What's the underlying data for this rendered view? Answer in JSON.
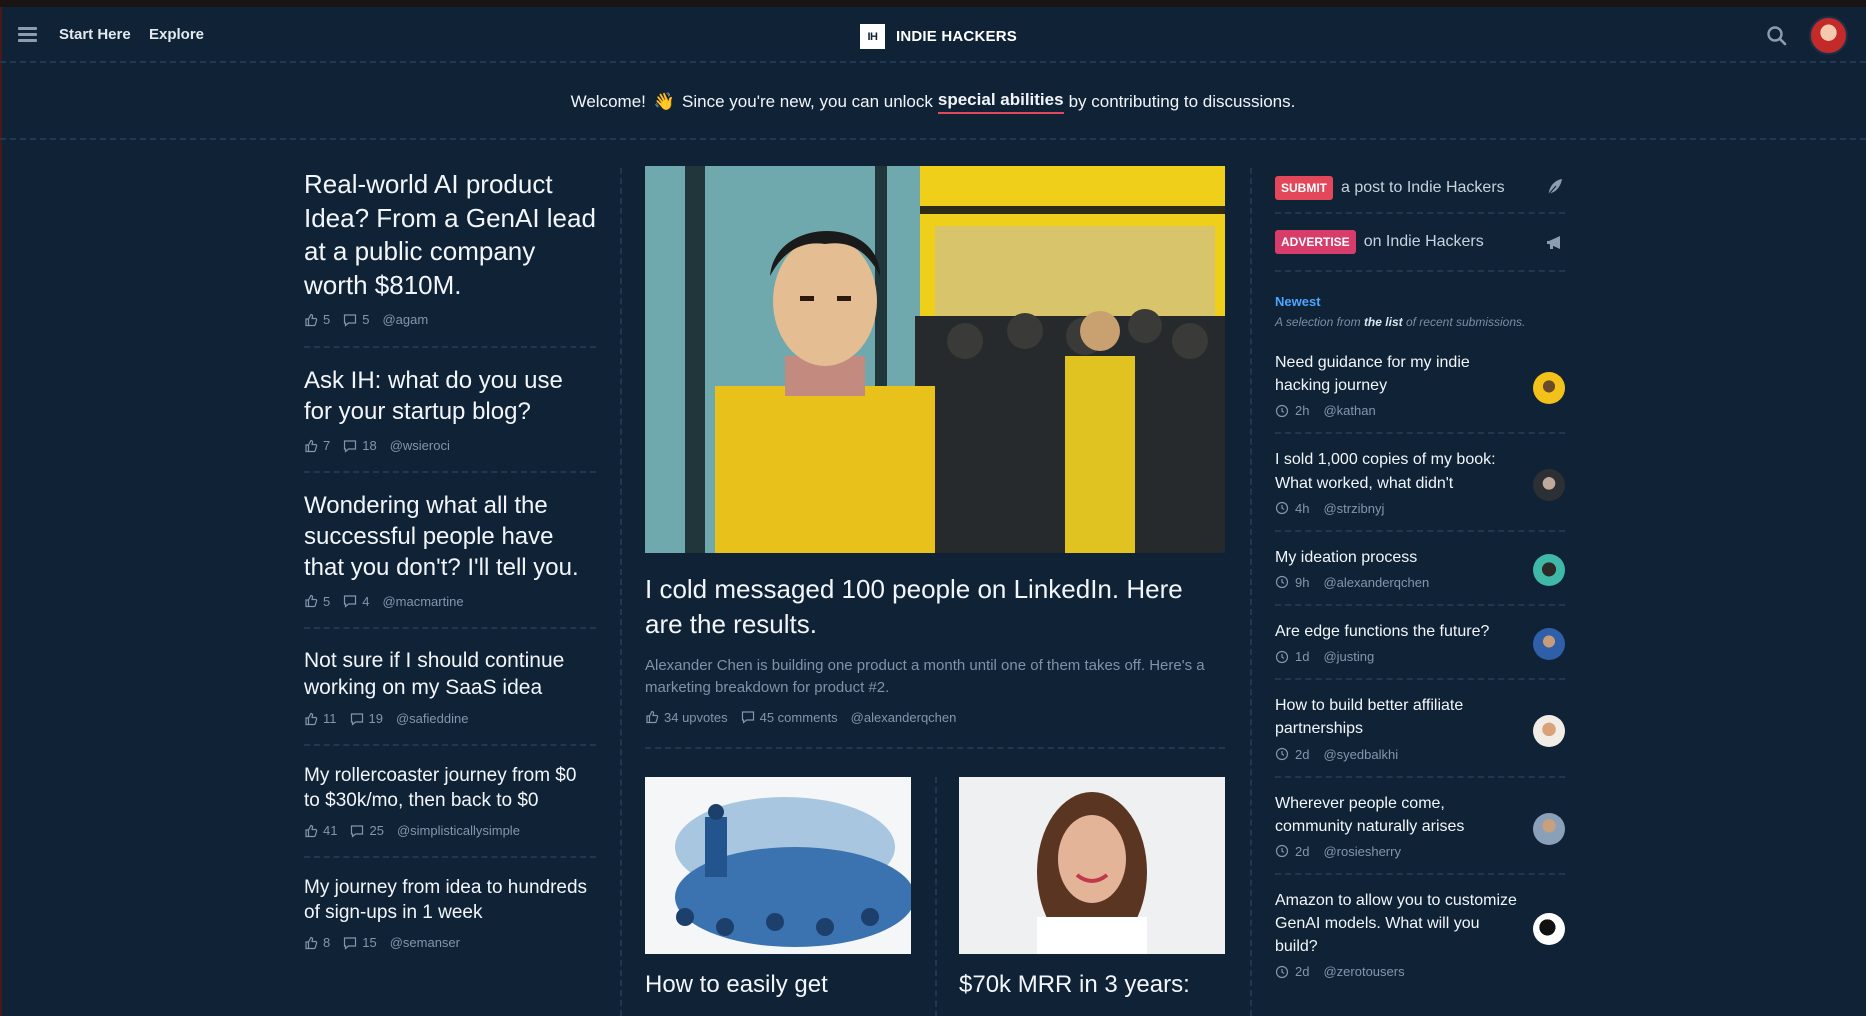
{
  "header": {
    "start_here": "Start Here",
    "explore": "Explore",
    "logo_text": "IH",
    "brand": "INDIE HACKERS"
  },
  "welcome": {
    "before": "Welcome!",
    "wave": "👋",
    "middle": "Since you're new, you can unlock",
    "link": "special abilities",
    "after": "by contributing to discussions."
  },
  "left_posts": [
    {
      "title": "Real-world AI product Idea? From a GenAI lead at a public company worth $810M.",
      "upvotes": "5",
      "comments": "5",
      "author": "@agam"
    },
    {
      "title": "Ask IH: what do you use for your startup blog?",
      "upvotes": "7",
      "comments": "18",
      "author": "@wsieroci"
    },
    {
      "title": "Wondering what all the successful people have that you don't? I'll tell you.",
      "upvotes": "5",
      "comments": "4",
      "author": "@macmartine"
    },
    {
      "title": "Not sure if I should continue working on my SaaS idea",
      "upvotes": "11",
      "comments": "19",
      "author": "@safieddine"
    },
    {
      "title": "My rollercoaster journey from $0 to $30k/mo, then back to $0",
      "upvotes": "41",
      "comments": "25",
      "author": "@simplisticallysimple"
    },
    {
      "title": "My journey from idea to hundreds of sign-ups in 1 week",
      "upvotes": "8",
      "comments": "15",
      "author": "@semanser"
    }
  ],
  "featured": {
    "title": "I cold messaged 100 people on LinkedIn. Here are the results.",
    "description": "Alexander Chen is building one product a month until one of them takes off. Here's a marketing breakdown for product #2.",
    "upvotes": "34 upvotes",
    "comments": "45 comments",
    "author": "@alexanderqchen"
  },
  "cards": [
    {
      "title": "How to easily get"
    },
    {
      "title": "$70k MRR in 3 years:"
    }
  ],
  "sidebar": {
    "submit_badge": "SUBMIT",
    "submit_text": "a post to Indie Hackers",
    "advertise_badge": "ADVERTISE",
    "advertise_text": "on Indie Hackers",
    "newest_label": "Newest",
    "newest_sub_before": "A selection from",
    "newest_sub_link": "the list",
    "newest_sub_after": "of recent submissions.",
    "posts": [
      {
        "title": "Need guidance for my indie hacking journey",
        "time": "2h",
        "author": "@kathan"
      },
      {
        "title": "I sold 1,000 copies of my book: What worked, what didn't",
        "time": "4h",
        "author": "@strzibnyj"
      },
      {
        "title": "My ideation process",
        "time": "9h",
        "author": "@alexanderqchen"
      },
      {
        "title": "Are edge functions the future?",
        "time": "1d",
        "author": "@justing"
      },
      {
        "title": "How to build better affiliate partnerships",
        "time": "2d",
        "author": "@syedbalkhi"
      },
      {
        "title": "Wherever people come, community naturally arises",
        "time": "2d",
        "author": "@rosiesherry"
      },
      {
        "title": "Amazon to allow you to customize GenAI models. What will you build?",
        "time": "2d",
        "author": "@zerotousers"
      }
    ]
  },
  "colors": {
    "background": "#0f2236",
    "accent_red": "#e2475a",
    "newest_blue": "#4da6ff",
    "muted_text": "#8396ab"
  }
}
